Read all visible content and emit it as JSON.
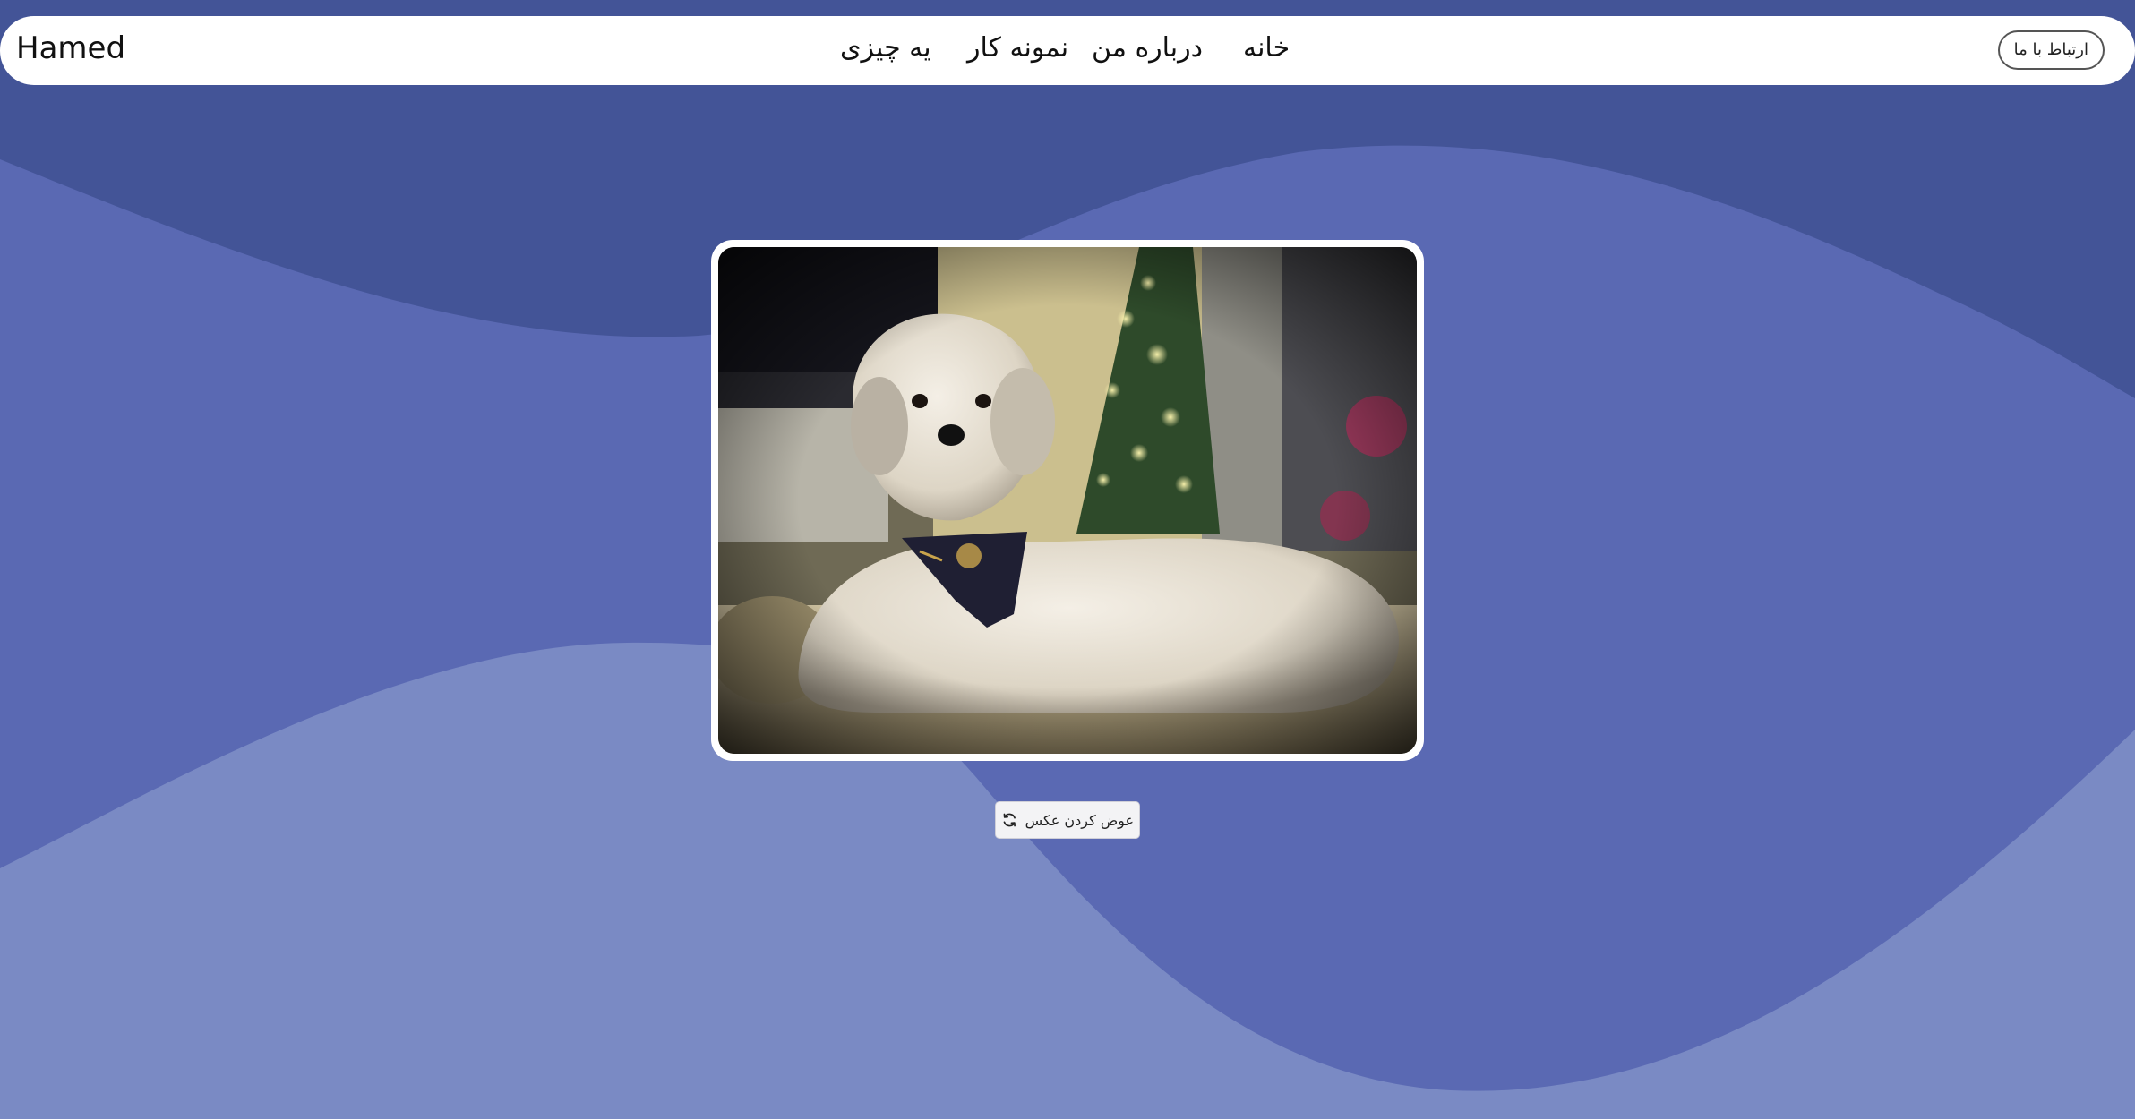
{
  "navbar": {
    "brand": "Hamed",
    "links": [
      {
        "label": "خانه"
      },
      {
        "label": "درباره من"
      },
      {
        "label": "نمونه کار"
      },
      {
        "label": "یه چیزی"
      }
    ],
    "contact_label": "ارتباط با ما"
  },
  "main": {
    "swap_button_label": "عوض کردن عکس",
    "swap_button_icon": "refresh-icon"
  },
  "colors": {
    "background_dark": "#435497",
    "wave_mid": "#5a69b3",
    "wave_light": "#7a8ac4",
    "navbar": "#ffffff"
  }
}
